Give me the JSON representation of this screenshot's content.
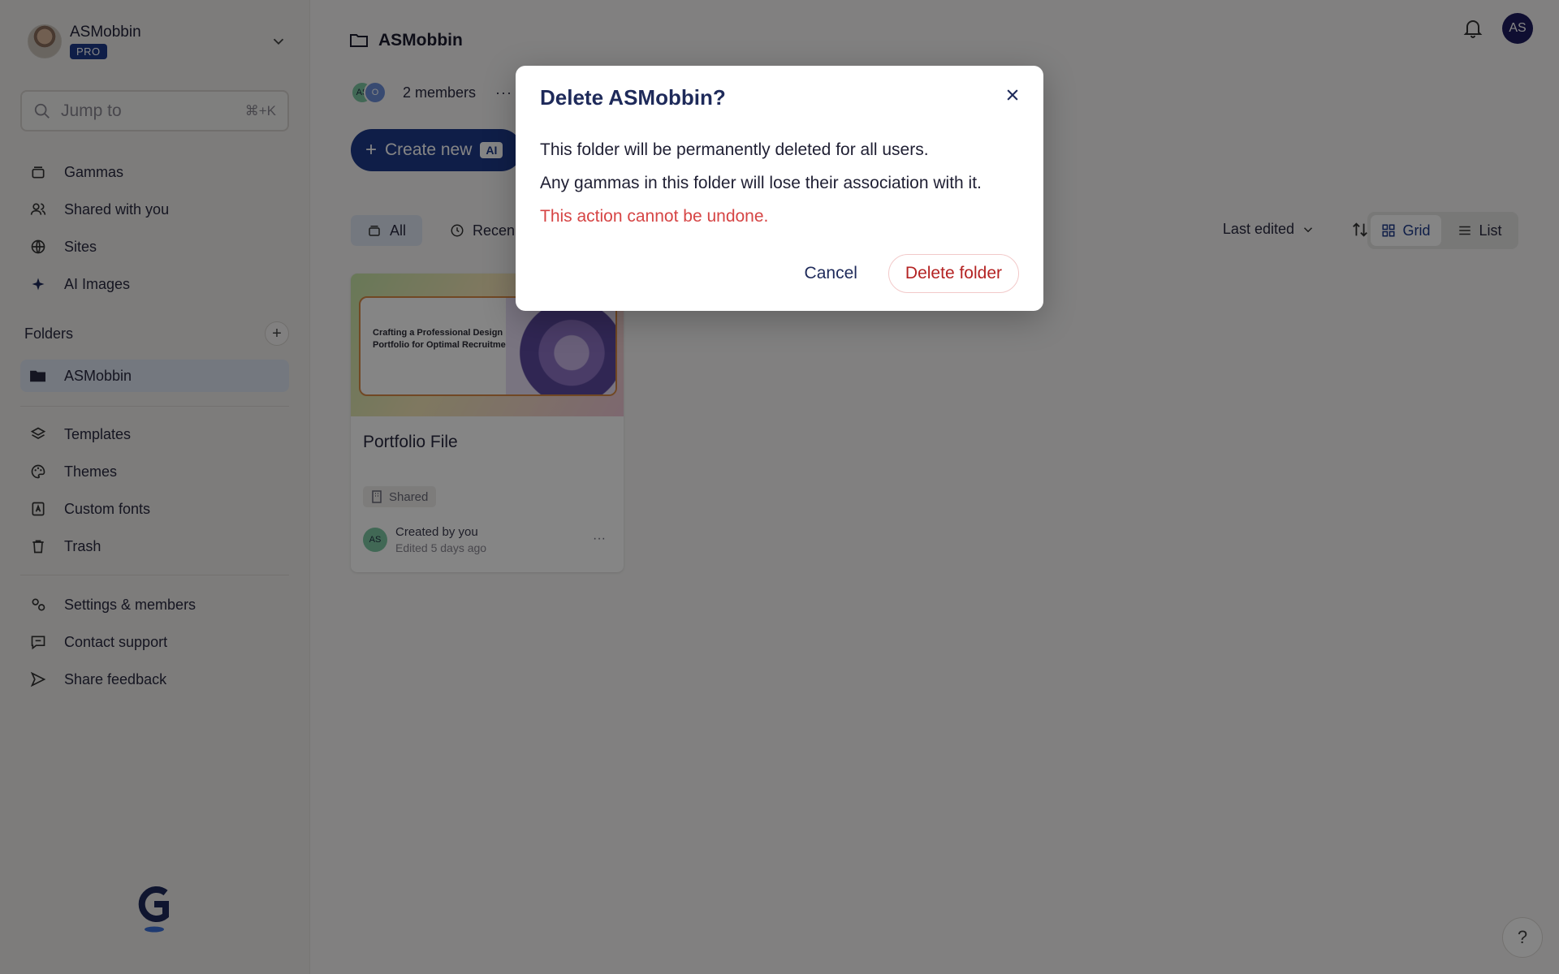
{
  "workspace": {
    "name": "ASMobbin",
    "plan_badge": "PRO"
  },
  "search": {
    "placeholder": "Jump to",
    "shortcut": "⌘+K"
  },
  "sidebar": {
    "nav": [
      {
        "label": "Gammas",
        "icon": "stack-icon"
      },
      {
        "label": "Shared with you",
        "icon": "users-icon"
      },
      {
        "label": "Sites",
        "icon": "globe-icon"
      },
      {
        "label": "AI Images",
        "icon": "sparkle-icon"
      }
    ],
    "folders_label": "Folders",
    "folders": [
      {
        "label": "ASMobbin",
        "active": true
      }
    ],
    "library": [
      {
        "label": "Templates",
        "icon": "layers-icon"
      },
      {
        "label": "Themes",
        "icon": "palette-icon"
      },
      {
        "label": "Custom fonts",
        "icon": "font-icon"
      },
      {
        "label": "Trash",
        "icon": "trash-icon"
      }
    ],
    "footer": [
      {
        "label": "Settings & members",
        "icon": "settings-icon"
      },
      {
        "label": "Contact support",
        "icon": "chat-icon"
      },
      {
        "label": "Share feedback",
        "icon": "send-icon"
      }
    ]
  },
  "header": {
    "breadcrumb": "ASMobbin",
    "avatar_initials": "AS",
    "members_count": "2 members",
    "member_initials": [
      "AS",
      "O"
    ]
  },
  "create": {
    "label": "Create new",
    "badge": "AI"
  },
  "filters": [
    {
      "label": "All",
      "active": true
    },
    {
      "label": "Recen",
      "active": false
    }
  ],
  "sort": {
    "label": "Last edited"
  },
  "view": {
    "grid": "Grid",
    "list": "List",
    "selected": "Grid"
  },
  "card": {
    "thumb_title": "Crafting a Professional Design Portfolio for Optimal Recruitment",
    "title": "Portfolio File",
    "tag": "Shared",
    "author_initials": "AS",
    "created_by": "Created by you",
    "edited": "Edited 5 days ago",
    "more": "···"
  },
  "help_label": "?",
  "modal": {
    "title": "Delete ASMobbin?",
    "line1": "This folder will be permanently deleted for all users.",
    "line2": "Any gammas in this folder will lose their association with it.",
    "warning": "This action cannot be undone.",
    "cancel": "Cancel",
    "confirm": "Delete folder"
  },
  "colors": {
    "accent": "#1e3a8a",
    "danger": "#d64545",
    "overlay": "rgba(0,0,0,0.48)"
  }
}
